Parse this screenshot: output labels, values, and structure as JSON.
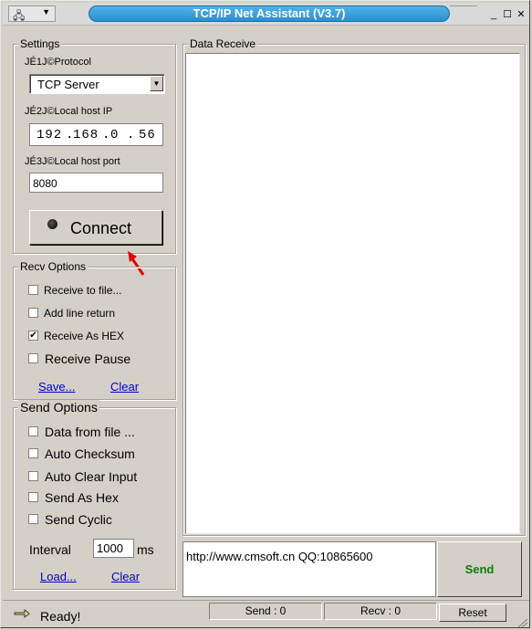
{
  "window": {
    "title": "TCP/IP Net Assistant (V3.7)"
  },
  "settings": {
    "legend": "Settings",
    "protocol_label": "JÉ1J©Protocol",
    "protocol_value": "TCP Server",
    "ip_label": "JÉ2J©Local host IP",
    "ip_parts": [
      "192",
      "168",
      "0",
      "56"
    ],
    "port_label": "JÉ3J©Local host port",
    "port_value": "8080",
    "connect_label": "Connect"
  },
  "recv_options": {
    "legend": "Recv Options",
    "items": [
      {
        "label": "Receive to file...",
        "checked": false
      },
      {
        "label": "Add line return",
        "checked": false
      },
      {
        "label": "Receive As HEX",
        "checked": true
      },
      {
        "label": "Receive Pause",
        "checked": false
      }
    ],
    "save_link": "Save...",
    "clear_link": "Clear"
  },
  "send_options": {
    "legend": "Send Options",
    "items": [
      {
        "label": "Data from file ...",
        "checked": false
      },
      {
        "label": "Auto Checksum",
        "checked": false
      },
      {
        "label": "Auto Clear Input",
        "checked": false
      },
      {
        "label": "Send As Hex",
        "checked": false
      },
      {
        "label": "Send Cyclic",
        "checked": false
      }
    ],
    "interval_label": "Interval",
    "interval_value": "1000",
    "interval_unit": "ms",
    "load_link": "Load...",
    "clear_link": "Clear"
  },
  "data_receive": {
    "legend": "Data Receive"
  },
  "send_area": {
    "text": "http://www.cmsoft.cn QQ:10865600",
    "send_label": "Send"
  },
  "statusbar": {
    "ready": "Ready!",
    "send_count": "Send : 0",
    "recv_count": "Recv : 0",
    "reset_label": "Reset"
  },
  "colors": {
    "title_bar": "#2a8fd0",
    "send_text": "#0a7d0a",
    "link": "#0000cc",
    "arrow": "#e00000"
  }
}
